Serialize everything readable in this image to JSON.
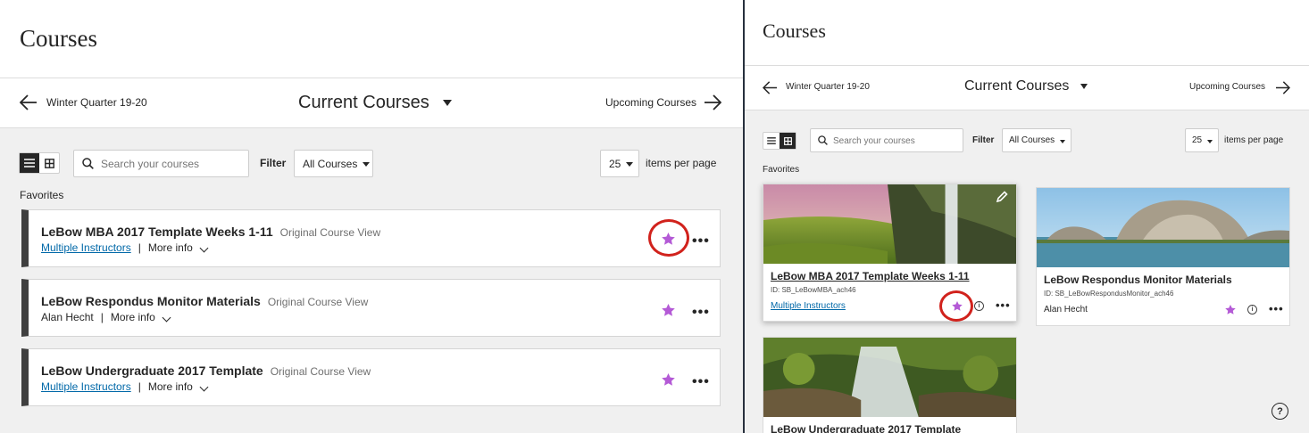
{
  "left": {
    "page_title": "Courses",
    "term_nav": {
      "previous": "Winter Quarter 19-20",
      "current": "Current Courses",
      "next": "Upcoming Courses"
    },
    "toolbar": {
      "search_placeholder": "Search your courses",
      "filter_label": "Filter",
      "filter_value": "All Courses",
      "per_page_value": "25",
      "per_page_label": "items per page"
    },
    "favorites_heading": "Favorites",
    "courses": [
      {
        "title": "LeBow MBA 2017 Template Weeks 1-11",
        "view": "Original Course View",
        "instructors": "Multiple Instructors",
        "instructors_is_link": true,
        "more": "More info",
        "favorite": true,
        "highlighted": true
      },
      {
        "title": "LeBow Respondus Monitor Materials",
        "view": "Original Course View",
        "instructors": "Alan Hecht",
        "instructors_is_link": false,
        "more": "More info",
        "favorite": true,
        "highlighted": false
      },
      {
        "title": "LeBow Undergraduate 2017 Template",
        "view": "Original Course View",
        "instructors": "Multiple Instructors",
        "instructors_is_link": true,
        "more": "More info",
        "favorite": true,
        "highlighted": false
      }
    ]
  },
  "right": {
    "page_title": "Courses",
    "term_nav": {
      "previous": "Winter Quarter 19-20",
      "current": "Current Courses",
      "next": "Upcoming Courses"
    },
    "toolbar": {
      "search_placeholder": "Search your courses",
      "filter_label": "Filter",
      "filter_value": "All Courses",
      "per_page_value": "25",
      "per_page_label": "items per page"
    },
    "favorites_heading": "Favorites",
    "cards": [
      {
        "title": "LeBow MBA 2017 Template Weeks 1-11",
        "id": "ID: SB_LeBowMBA_ach46",
        "instructors": "Multiple Instructors"
      },
      {
        "title": "LeBow Respondus Monitor Materials",
        "id": "ID: SB_LeBowRespondusMonitor_ach46",
        "instructors": "Alan Hecht"
      },
      {
        "title": "LeBow Undergraduate 2017 Template"
      }
    ]
  },
  "colors": {
    "star": "#b45ad6",
    "highlight_ring": "#d1221c",
    "link": "#0068a8",
    "row_accent": "#3f3f3f"
  },
  "icons": {
    "favorite": "star-icon",
    "more": "ellipsis-icon",
    "info": "info-icon",
    "edit": "pencil-icon",
    "help": "help-icon"
  }
}
